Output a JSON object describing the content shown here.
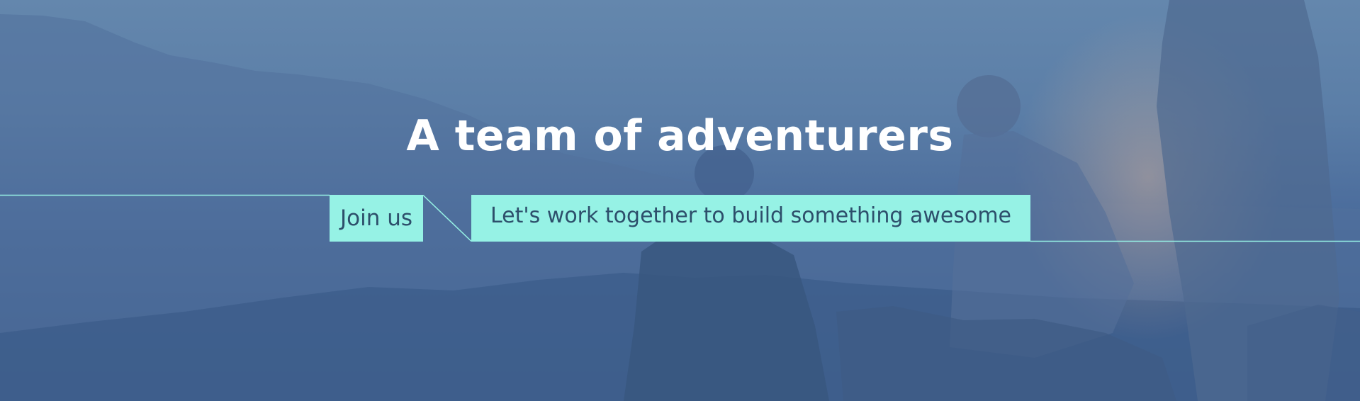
{
  "hero": {
    "headline": "A team of adventurers",
    "join_button_label": "Join us",
    "tagline": "Let's work together to build something awesome",
    "background_icon": "adventurers-photo",
    "colors": {
      "overlay": "#5b7ea7",
      "accent": "#96f2e5",
      "accent_text": "#2d4f6b",
      "headline_text": "#ffffff"
    }
  }
}
